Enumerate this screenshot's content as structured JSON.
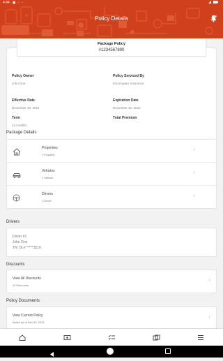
{
  "status_bar": {
    "time": "4:44",
    "system_icons": "▣ ◦ ▫"
  },
  "header": {
    "title": "Policy Details",
    "icon": "bell-icon"
  },
  "package_card": {
    "label": "Package Policy",
    "number": "#1234567890"
  },
  "summary": {
    "policy_owner_label": "Policy Owner",
    "policy_owner_value": "John Doe",
    "serviced_by_label": "Policy Serviced By",
    "serviced_by_value": "Encompass Insurance",
    "effective_label": "Effective Date",
    "effective_value": "December 30, 2021",
    "expiration_label": "Expiration Date",
    "expiration_value": "December 30, 2022",
    "term_label": "Term",
    "term_value": "12 months",
    "premium_label": "Total Premium"
  },
  "package_details": {
    "title": "Package Details",
    "items": [
      {
        "label": "Properties",
        "sub": "1 Property",
        "icon": "house-icon"
      },
      {
        "label": "Vehicles",
        "sub": "1 Vehicle",
        "icon": "car-icon"
      },
      {
        "label": "Drivers",
        "sub": "1 Driver",
        "icon": "steering-wheel-icon"
      }
    ]
  },
  "drivers": {
    "title": "Drivers",
    "driver_num": "Driver #1",
    "name": "John Doe",
    "license": "TN: DL# *****3516"
  },
  "discounts": {
    "title": "Discounts",
    "label": "View All Discounts",
    "sub": "10 Discounts"
  },
  "documents": {
    "title": "Policy Documents",
    "label": "View Current Policy",
    "sub": "Active as of Dec 30, 2021"
  },
  "tabs": [
    {
      "label": "Home",
      "icon": "home-icon"
    },
    {
      "label": "Payments",
      "icon": "payments-icon"
    },
    {
      "label": "Policies",
      "icon": "policies-icon"
    },
    {
      "label": "Claims",
      "icon": "claims-icon"
    },
    {
      "label": "More",
      "icon": "menu-icon"
    }
  ],
  "colors": {
    "brand": "#d1401c"
  }
}
